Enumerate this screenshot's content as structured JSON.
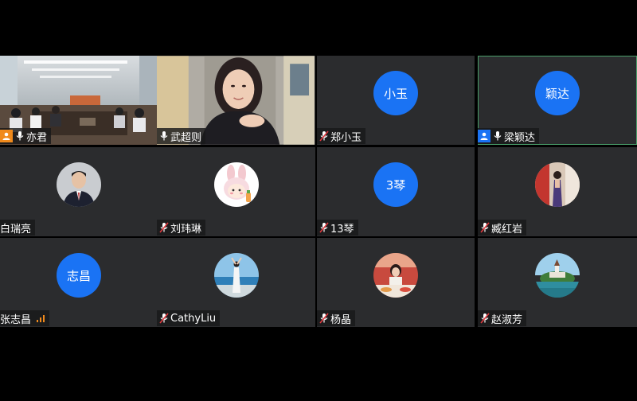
{
  "participants": [
    {
      "name": "亦君",
      "mic": "on",
      "host_badge": true,
      "host_badge_color": "#f08a1c",
      "video": "meeting-room"
    },
    {
      "name": "武超则",
      "mic": "on",
      "video": "woman-webcam"
    },
    {
      "name": "郑小玉",
      "initials": "小玉",
      "mic": "muted"
    },
    {
      "name": "梁颖达",
      "initials": "颖达",
      "mic": "on",
      "host_badge": true,
      "host_badge_color": "#1a73f4",
      "active_speaker": true
    },
    {
      "name": "白瑞亮",
      "mic": "none",
      "avatar_icon": "man-in-suit-avatar"
    },
    {
      "name": "刘玮琳",
      "mic": "muted",
      "avatar_icon": "bunny-cartoon-avatar"
    },
    {
      "name": "13琴",
      "initials": "3琴",
      "mic": "muted"
    },
    {
      "name": "臧红岩",
      "mic": "muted",
      "avatar_icon": "woman-red-wall-avatar"
    },
    {
      "name": "张志昌",
      "initials": "志昌",
      "mic": "none",
      "signal": true,
      "signal_color": "#f08a1c"
    },
    {
      "name": "CathyLiu",
      "mic": "muted",
      "avatar_icon": "woman-seaside-avatar"
    },
    {
      "name": "杨晶",
      "mic": "muted",
      "avatar_icon": "woman-dining-avatar"
    },
    {
      "name": "赵淑芳",
      "mic": "muted",
      "avatar_icon": "lake-church-avatar"
    }
  ],
  "colors": {
    "background": "#000000",
    "tile": "#2b2c2e",
    "avatar_blue": "#1a73f4",
    "muted_red": "#e0393e",
    "active_border": "#4a9e6a"
  }
}
